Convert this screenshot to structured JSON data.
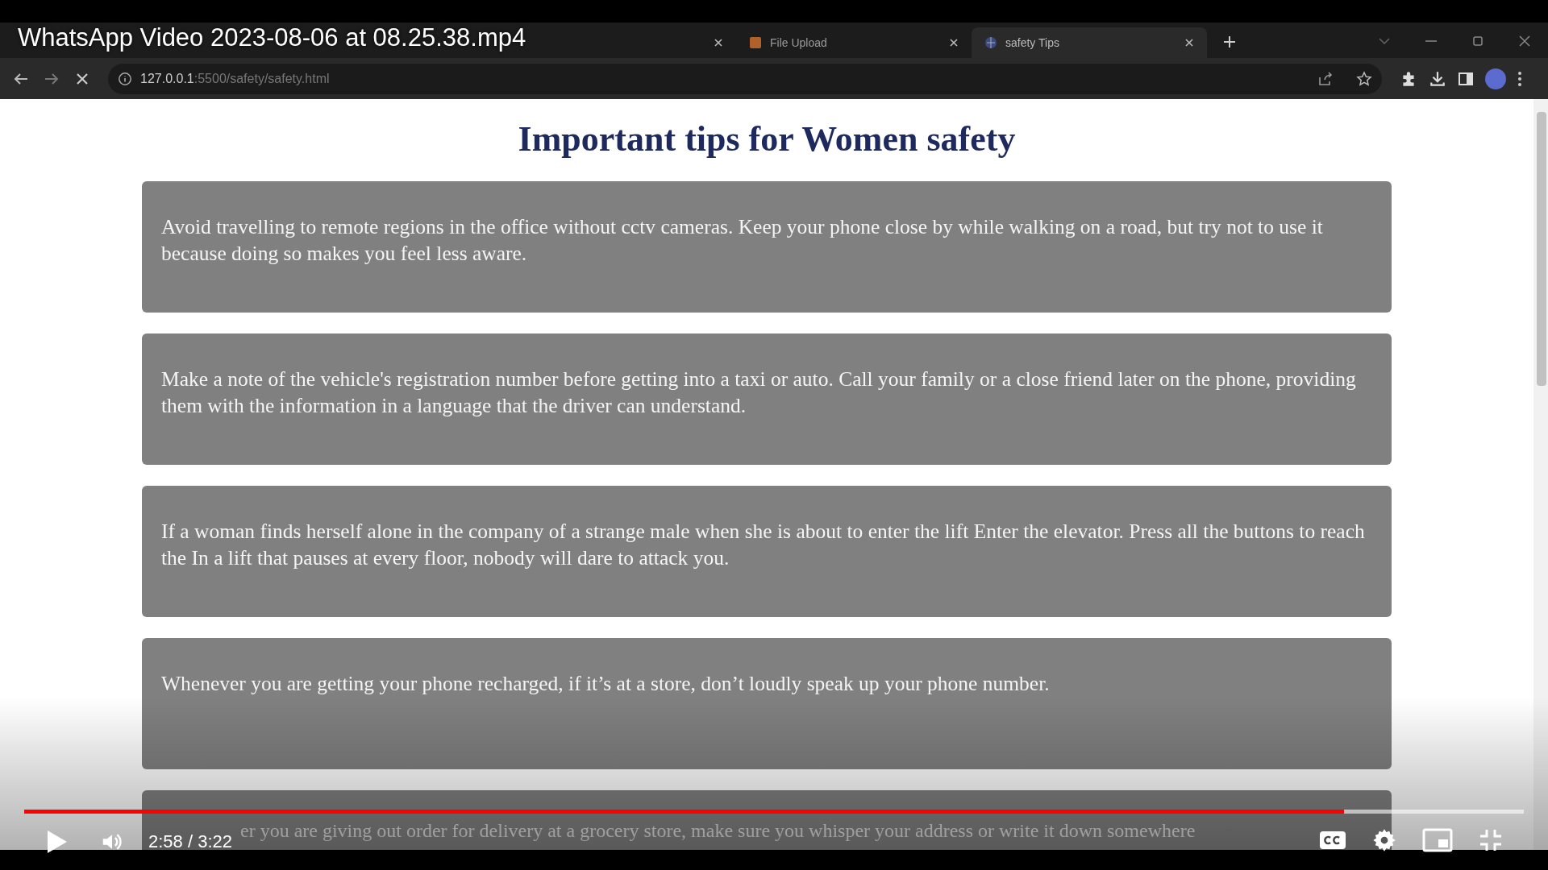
{
  "video": {
    "title": "WhatsApp Video 2023-08-06 at 08.25.38.mp4",
    "playing": false,
    "level": 0.88,
    "time": "2:58 / 3:22"
  },
  "browser": {
    "tabs": [
      {
        "selected": false
      },
      {
        "label": "File Upload",
        "selected": false
      },
      {
        "label": "safety Tips",
        "selected": true
      }
    ],
    "address": {
      "host": "127.0.0.1",
      "path": ":5500/safety/safety.html"
    }
  },
  "page": {
    "heading": "Important tips for Women safety",
    "tips": [
      "Avoid travelling to remote regions in the office without cctv cameras. Keep your phone close by while walking on a road, but try not to use it because doing so makes you feel less aware.",
      "Make a note of the vehicle's registration number before getting into a taxi or auto. Call your family or a close friend later on the phone, providing them with the information in a language that the driver can understand.",
      "If a woman finds herself alone in the company of a strange male when she is about to enter the lift Enter the elevator. Press all the buttons to reach the In a lift that pauses at every floor, nobody will dare to attack you.",
      "Whenever you are getting your phone recharged, if it’s at a store, don’t loudly speak up your phone number.",
      "er you are giving out order for delivery at a grocery store, make sure you whisper your address or write it down somewhere"
    ]
  }
}
